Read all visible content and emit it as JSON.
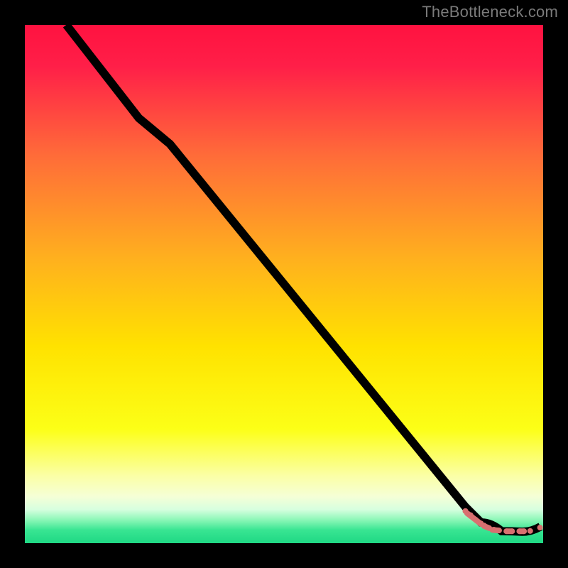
{
  "watermark": "TheBottleneck.com",
  "colors": {
    "background_top": "#ff1a4b",
    "background_mid1": "#ff8a2a",
    "background_mid2": "#ffe400",
    "background_low": "#fbffb0",
    "background_green": "#2fe98e",
    "curve": "#000000",
    "dots": "#d87070",
    "frame": "#000000"
  },
  "chart_data": {
    "type": "line",
    "title": "",
    "xlabel": "",
    "ylabel": "",
    "xlim": [
      0,
      100
    ],
    "ylim": [
      0,
      100
    ],
    "grid": false,
    "legend": false,
    "series": [
      {
        "name": "curve",
        "x": [
          8,
          22,
          28,
          85,
          88,
          92,
          96,
          99.5
        ],
        "y": [
          100,
          82,
          77,
          7,
          4,
          2.3,
          2.2,
          3.2
        ]
      }
    ],
    "dots": {
      "name": "bottom-cluster",
      "x": [
        85,
        86,
        87,
        88,
        88.6,
        89.3,
        90.5,
        91.3,
        93,
        94,
        95.5,
        96.3,
        97.5,
        99.4
      ],
      "y": [
        6.2,
        5.4,
        4.5,
        3.8,
        3.4,
        3.0,
        2.6,
        2.45,
        2.3,
        2.3,
        2.3,
        2.3,
        2.35,
        3.0
      ]
    },
    "capsules": [
      {
        "x1": 85.3,
        "y1": 5.8,
        "x2": 88.0,
        "y2": 3.7
      },
      {
        "x1": 88.6,
        "y1": 3.3,
        "x2": 89.6,
        "y2": 2.9
      },
      {
        "x1": 90.2,
        "y1": 2.55,
        "x2": 91.5,
        "y2": 2.45
      },
      {
        "x1": 92.9,
        "y1": 2.3,
        "x2": 94.0,
        "y2": 2.3
      },
      {
        "x1": 95.4,
        "y1": 2.3,
        "x2": 96.3,
        "y2": 2.3
      }
    ]
  }
}
